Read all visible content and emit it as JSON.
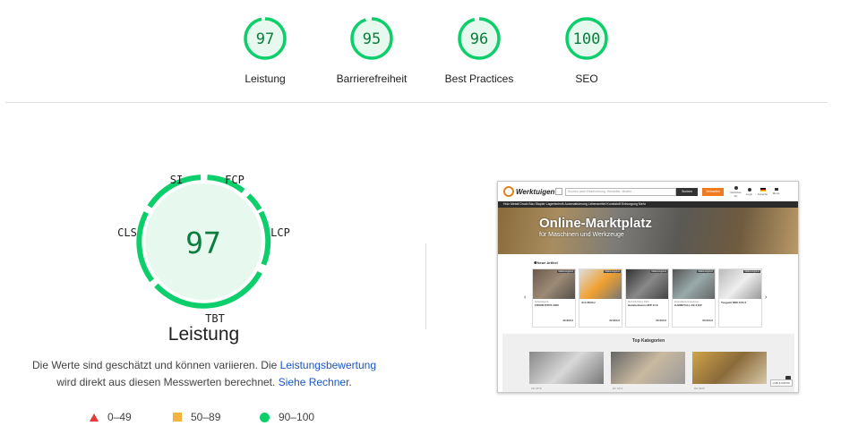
{
  "categories": [
    {
      "score": "97",
      "label": "Leistung",
      "fraction": 0.97
    },
    {
      "score": "95",
      "label": "Barrierefreiheit",
      "fraction": 0.95
    },
    {
      "score": "96",
      "label": "Best Practices",
      "fraction": 0.96
    },
    {
      "score": "100",
      "label": "SEO",
      "fraction": 1.0
    }
  ],
  "performance": {
    "score": "97",
    "title": "Leistung",
    "metrics": {
      "si": "SI",
      "fcp": "FCP",
      "lcp": "LCP",
      "tbt": "TBT",
      "cls": "CLS"
    },
    "description_1": "Die Werte sind geschätzt und können variieren. Die ",
    "link_1": "Leistungsbewertung",
    "description_2": "wird direkt aus diesen Messwerten berechnet. ",
    "link_2": "Siehe Rechner",
    "description_end": "."
  },
  "legend": {
    "fail": "0–49",
    "average": "50–89",
    "pass": "90–100"
  },
  "colors": {
    "pass": "#0cce6b",
    "pass_text": "#0a7d3c",
    "pass_bg": "#e7f9ef",
    "average": "#f4b33c",
    "fail": "#e53935",
    "link": "#1a56c4"
  },
  "screenshot": {
    "logo_text": "Werktuigen",
    "search_placeholder": "Suchen nach Bezeichnung, Hersteller, Modell...",
    "search_button": "Suchen",
    "sell_button": "Verkaufen",
    "icons": [
      "Merkliste (0)",
      "Login",
      "Sprache",
      "Menü"
    ],
    "nav": "Holz  Metall  Druck  Bau  Stapler  Lagertechnik  Automatisierung  Lebensmittel  Kunststoff  Entsorgung  Mehr",
    "hero_title": "Online-Marktplatz",
    "hero_subtitle": "für Maschinen und Werkzeuge",
    "new_title": "Neue Artikel",
    "cards": [
      {
        "badge": "Maklerangebot",
        "cat": "Schweißgerät",
        "name": "FRONIUSTPS 3000",
        "price": "32.900 €"
      },
      {
        "badge": "Maklerangebot",
        "cat": "",
        "name": "JLG 800AJ",
        "price": "22.900 €"
      },
      {
        "badge": "Maklerangebot",
        "cat": "Rechtsbyhitzen 3000",
        "name": "Hammelmann HDP 44 E",
        "price": "65.000 €"
      },
      {
        "badge": "Maklerangebot",
        "cat": "Doppelkantenmaschinen",
        "name": "AJZMETALL AB 3 EIV",
        "price": "65.000 €"
      },
      {
        "badge": "Maklerangebot",
        "cat": "",
        "name": "Tsugami M08 SYE II",
        "price": ""
      }
    ],
    "topkat_title": "Top Kategorien",
    "kats": [
      "CE 1870",
      "EX 4271",
      "DE 6625"
    ],
    "chat": "LOB & KRITIK"
  }
}
